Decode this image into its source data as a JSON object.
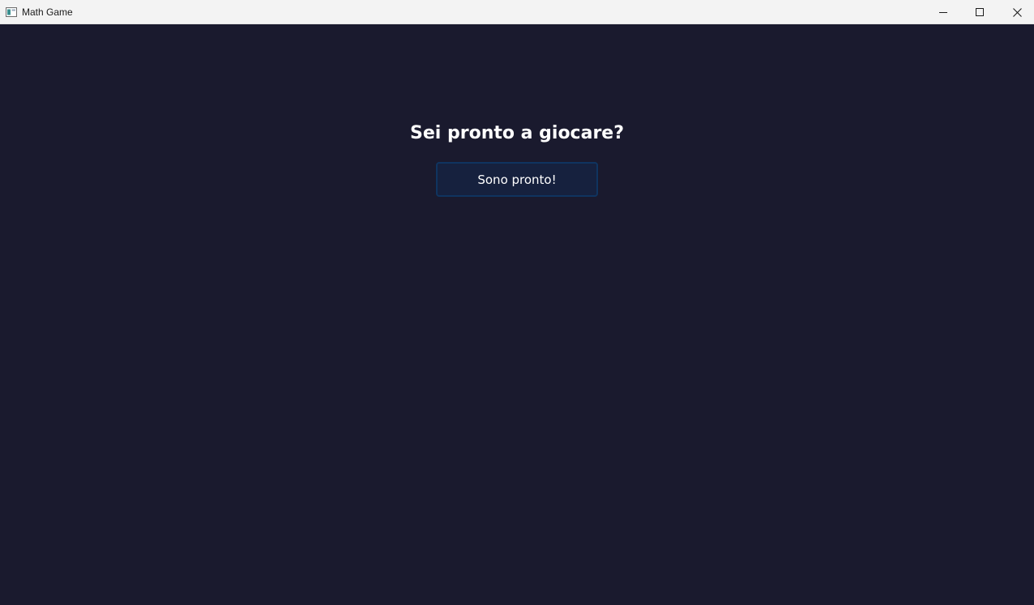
{
  "window": {
    "title": "Math Game",
    "app_icon": "window-app-icon",
    "controls": {
      "minimize_icon": "minimize-icon",
      "maximize_icon": "maximize-icon",
      "close_icon": "close-icon"
    }
  },
  "main": {
    "heading": "Sei pronto a giocare?",
    "ready_button_label": "Sono pronto!"
  },
  "colors": {
    "background": "#1a1a2e",
    "button_background": "#16213e",
    "button_border": "#0f3460",
    "text": "#ffffff",
    "titlebar": "#f3f3f3"
  }
}
